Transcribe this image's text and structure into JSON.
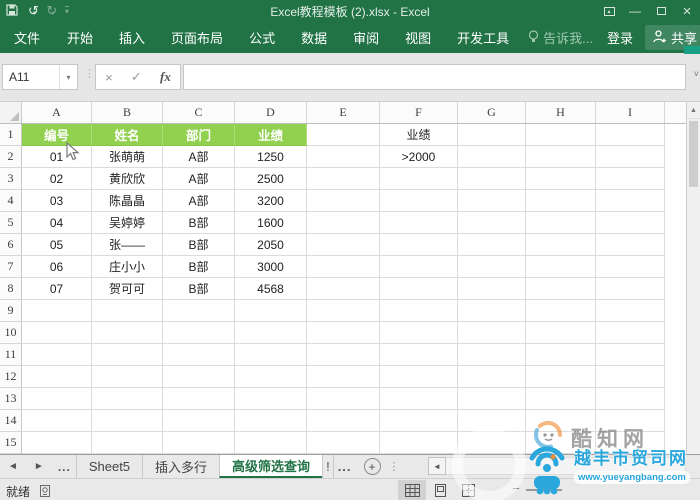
{
  "colors": {
    "excel_green": "#217346",
    "header_fill": "#92d050",
    "watermark_blue": "#2aa7dd",
    "watermark_orange": "#f08c2e"
  },
  "title_bar": {
    "title": "Excel教程模板 (2).xlsx - Excel",
    "minimize": "—",
    "close": "×"
  },
  "icons": {
    "undo": "↺",
    "redo": "↻",
    "dropdown": "▾",
    "qat_customize": "▾",
    "cancel": "×",
    "check": "✓",
    "fx": "fx",
    "expand": "˅",
    "scroll_up": "▲",
    "tab_prev": "◄",
    "tab_next": "►",
    "more": "...",
    "vdots": "⋮",
    "hscroll_left": "◄",
    "add": "+",
    "zoom_out": "−",
    "sep": "⋮"
  },
  "ribbon": {
    "tabs": [
      {
        "label": "文件"
      },
      {
        "label": "开始"
      },
      {
        "label": "插入"
      },
      {
        "label": "页面布局"
      },
      {
        "label": "公式"
      },
      {
        "label": "数据"
      },
      {
        "label": "审阅"
      },
      {
        "label": "视图"
      },
      {
        "label": "开发工具"
      }
    ],
    "tell_me": "告诉我...",
    "sign_in": "登录",
    "share": "共享"
  },
  "formula_bar": {
    "name_box": "A11",
    "value": ""
  },
  "sheet": {
    "columns": [
      "A",
      "B",
      "C",
      "D",
      "E",
      "F",
      "G",
      "H",
      "I"
    ],
    "row_count": 15,
    "green_header_cells": [
      "A1",
      "B1",
      "C1",
      "D1"
    ],
    "cells": {
      "A1": "编号",
      "B1": "姓名",
      "C1": "部门",
      "D1": "业绩",
      "F1": "业绩",
      "A2": "01",
      "B2": "张萌萌",
      "C2": "A部",
      "D2": "1250",
      "F2": ">2000",
      "A3": "02",
      "B3": "黄欣欣",
      "C3": "A部",
      "D3": "2500",
      "A4": "03",
      "B4": "陈晶晶",
      "C4": "A部",
      "D4": "3200",
      "A5": "04",
      "B5": "吴婷婷",
      "C5": "B部",
      "D5": "1600",
      "A6": "05",
      "B6": "张——",
      "C6": "B部",
      "D6": "2050",
      "A7": "06",
      "B7": "庄小小",
      "C7": "B部",
      "D7": "3000",
      "A8": "07",
      "B8": "贺可可",
      "C8": "B部",
      "D8": "4568"
    }
  },
  "sheet_tabs": {
    "tabs": [
      {
        "label": "Sheet5",
        "active": false
      },
      {
        "label": "插入多行",
        "active": false
      },
      {
        "label": "高级筛选查询",
        "active": true
      },
      {
        "label": "!",
        "active": false
      }
    ],
    "overflow": "..."
  },
  "status_bar": {
    "ready": "就绪"
  },
  "watermarks": {
    "kuzhi": {
      "text": "酷知网"
    },
    "yueyang": {
      "text": "越丰市贸司网",
      "url": "www.yueyangbang.com"
    }
  }
}
